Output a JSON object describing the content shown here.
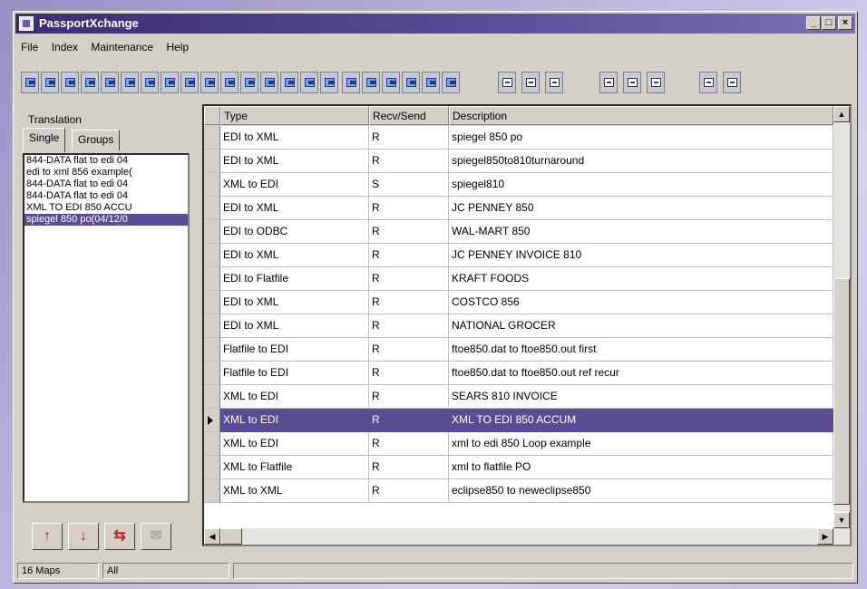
{
  "window": {
    "title": "PassportXchange"
  },
  "menu": [
    "File",
    "Index",
    "Maintenance",
    "Help"
  ],
  "left_panel": {
    "title": "Translation",
    "tabs": [
      "Single",
      "Groups"
    ],
    "items": [
      "844-DATA flat to edi 04",
      "edi to xml 856 example(",
      "844-DATA flat to edi 04",
      "844-DATA flat to edi 04",
      "XML TO EDI 850 ACCU",
      "spiegel 850 po(04/12/0"
    ],
    "selected_index": 5
  },
  "grid": {
    "columns": [
      "Type",
      "Recv/Send",
      "Description"
    ],
    "rows": [
      {
        "type": "EDI to XML",
        "rs": "R",
        "desc": "spiegel 850 po"
      },
      {
        "type": "EDI to XML",
        "rs": "R",
        "desc": "spiegel850to810turnaround"
      },
      {
        "type": "XML to EDI",
        "rs": "S",
        "desc": "spiegel810"
      },
      {
        "type": "EDI to XML",
        "rs": "R",
        "desc": "JC PENNEY 850"
      },
      {
        "type": "EDI to ODBC",
        "rs": "R",
        "desc": "WAL-MART 850"
      },
      {
        "type": "EDI to XML",
        "rs": "R",
        "desc": "JC PENNEY INVOICE 810"
      },
      {
        "type": "EDI to Flatfile",
        "rs": "R",
        "desc": "KRAFT FOODS"
      },
      {
        "type": "EDI to XML",
        "rs": "R",
        "desc": "COSTCO 856"
      },
      {
        "type": "EDI to XML",
        "rs": "R",
        "desc": "NATIONAL GROCER"
      },
      {
        "type": "Flatfile to EDI",
        "rs": "R",
        "desc": "ftoe850.dat to ftoe850.out first"
      },
      {
        "type": "Flatfile to EDI",
        "rs": "R",
        "desc": "ftoe850.dat to ftoe850.out ref recur"
      },
      {
        "type": "XML to EDI",
        "rs": "R",
        "desc": "SEARS 810 INVOICE"
      },
      {
        "type": "XML to EDI",
        "rs": "R",
        "desc": "XML TO EDI 850 ACCUM"
      },
      {
        "type": "XML to EDI",
        "rs": "R",
        "desc": "xml to edi 850 Loop example"
      },
      {
        "type": "XML to Flatfile",
        "rs": "R",
        "desc": "xml to flatfile PO"
      },
      {
        "type": "XML to XML",
        "rs": "R",
        "desc": "eclipse850 to neweclipse850"
      }
    ],
    "selected_index": 12
  },
  "status": {
    "count": "16 Maps",
    "filter": "All"
  },
  "colors": {
    "accent": "#5a4c94",
    "titlebar": "#3b2d6e",
    "face": "#d4d0c8"
  }
}
